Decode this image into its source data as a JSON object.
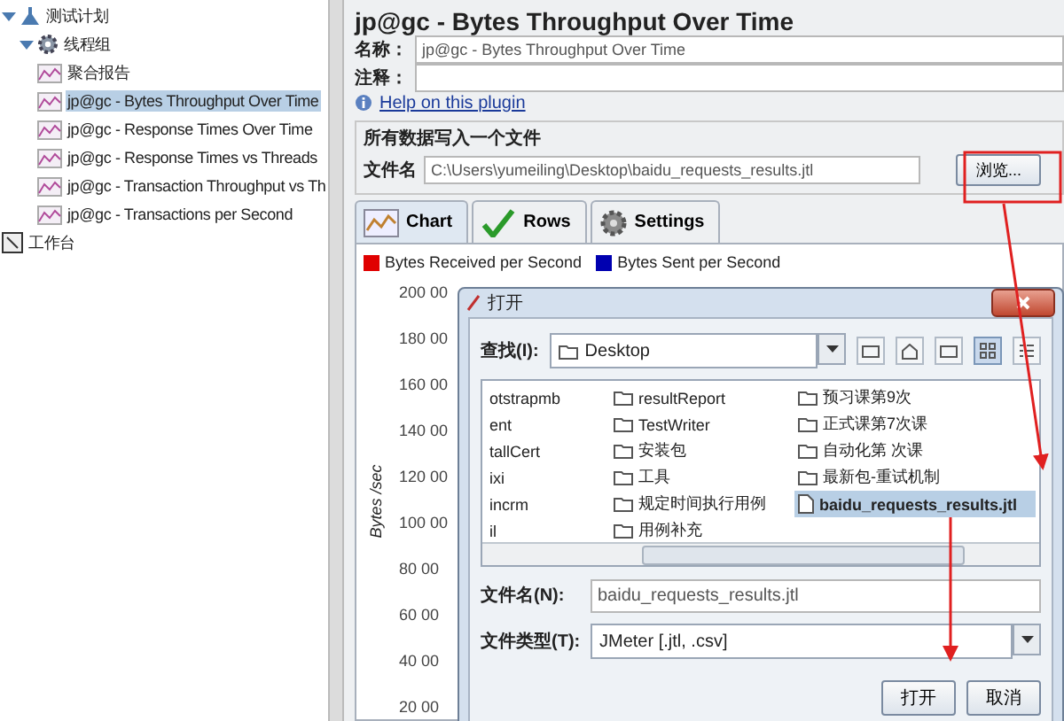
{
  "tree": [
    {
      "label": "测试计划",
      "kind": "plan",
      "expanded": true,
      "selected": false,
      "children": [
        {
          "label": "线程组",
          "kind": "group",
          "expanded": true,
          "selected": false,
          "children": [
            {
              "label": "聚合报告",
              "kind": "listener",
              "selected": false
            },
            {
              "label": "jp@gc - Bytes Throughput Over Time",
              "kind": "listener",
              "selected": true
            },
            {
              "label": "jp@gc - Response Times Over Time",
              "kind": "listener",
              "selected": false
            },
            {
              "label": "jp@gc - Response Times vs Threads",
              "kind": "listener",
              "selected": false
            },
            {
              "label": "jp@gc - Transaction Throughput vs Th",
              "kind": "listener",
              "selected": false
            },
            {
              "label": "jp@gc - Transactions per Second",
              "kind": "listener",
              "selected": false
            }
          ]
        }
      ]
    },
    {
      "label": "工作台",
      "kind": "workbench",
      "selected": false
    }
  ],
  "panel": {
    "title": "jp@gc - Bytes Throughput Over Time",
    "name_label": "名称：",
    "name_value": "jp@gc - Bytes Throughput Over Time",
    "comment_label": "注释：",
    "help_link": "Help on this plugin",
    "file_group_title": "所有数据写入一个文件",
    "file_label": "文件名",
    "file_value": "C:\\Users\\yumeiling\\Desktop\\baidu_requests_results.jtl",
    "browse_button": "浏览...",
    "tabs": [
      {
        "label": "Chart",
        "kind": "chart",
        "selected": true
      },
      {
        "label": "Rows",
        "kind": "rows",
        "selected": false
      },
      {
        "label": "Settings",
        "kind": "settings",
        "selected": false
      }
    ],
    "chart": {
      "legend": [
        {
          "label": "Bytes Received per Second",
          "color": "#e00000"
        },
        {
          "label": "Bytes Sent per Second",
          "color": "#0000b0"
        }
      ],
      "y_axis_label": "Bytes /sec",
      "y_tick_labels": [
        "200 00",
        "180 00",
        "160 00",
        "140 00",
        "120 00",
        "100 00",
        "80 00",
        "60 00",
        "40 00",
        "20 00"
      ]
    }
  },
  "dialog": {
    "title": "打开",
    "look_in_label": "查找(I):",
    "look_in_value": "Desktop",
    "files": [
      {
        "name": "otstrapmb",
        "kind": "folder",
        "selected": false
      },
      {
        "name": "ent",
        "kind": "folder",
        "selected": false
      },
      {
        "name": "tallCert",
        "kind": "folder",
        "selected": false
      },
      {
        "name": "ixi",
        "kind": "folder",
        "selected": false
      },
      {
        "name": "incrm",
        "kind": "folder",
        "selected": false
      },
      {
        "name": "il",
        "kind": "folder",
        "selected": false
      },
      {
        "name": "resultReport",
        "kind": "folder",
        "selected": false
      },
      {
        "name": "TestWriter",
        "kind": "folder",
        "selected": false
      },
      {
        "name": "安装包",
        "kind": "folder",
        "selected": false
      },
      {
        "name": "工具",
        "kind": "folder",
        "selected": false
      },
      {
        "name": "规定时间执行用例",
        "kind": "folder",
        "selected": false
      },
      {
        "name": "用例补充",
        "kind": "folder",
        "selected": false
      },
      {
        "name": "预习课第9次",
        "kind": "folder",
        "selected": false
      },
      {
        "name": "正式课第7次课",
        "kind": "folder",
        "selected": false
      },
      {
        "name": "自动化第 次课",
        "kind": "folder",
        "selected": false
      },
      {
        "name": "最新包-重试机制",
        "kind": "folder",
        "selected": false
      },
      {
        "name": "baidu_requests_results.jtl",
        "kind": "file",
        "selected": true
      }
    ],
    "file_name_label": "文件名(N):",
    "file_name_value": "baidu_requests_results.jtl",
    "file_type_label": "文件类型(T):",
    "file_type_value": "JMeter [.jtl, .csv]",
    "buttons": [
      "打开",
      "取消"
    ]
  }
}
